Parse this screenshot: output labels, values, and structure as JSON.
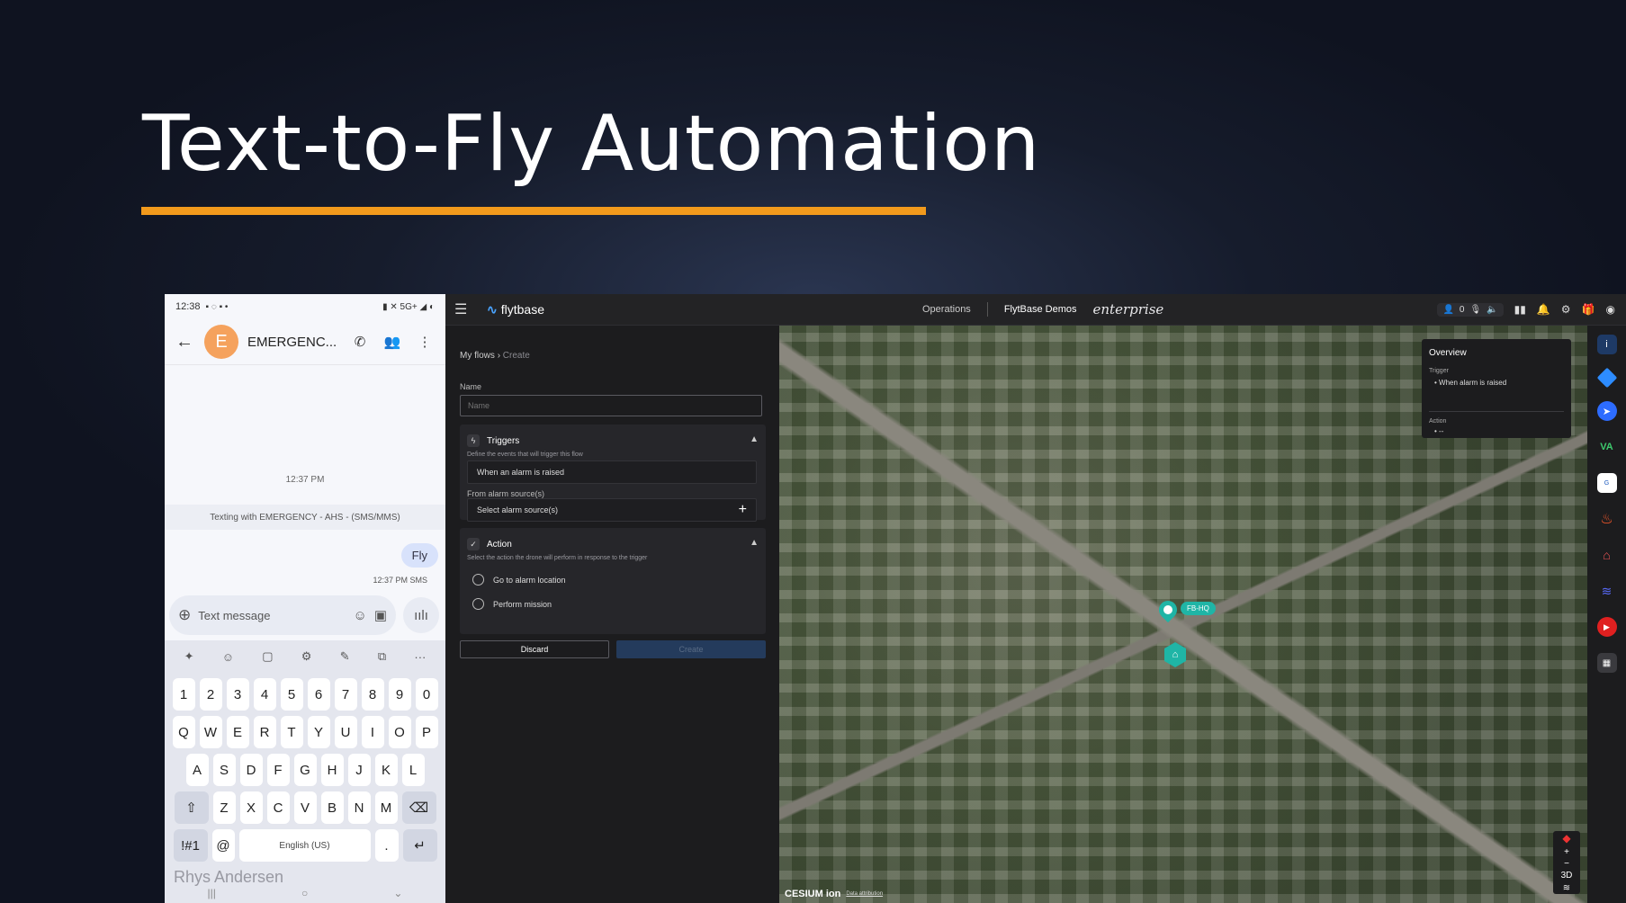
{
  "slide": {
    "title": "Text-to-Fly Automation"
  },
  "phone": {
    "status_time": "12:38",
    "status_icons": "▪ ◌ ▪ •",
    "status_right": "▮ ✕ 5G+ ◢ ◐",
    "contact_initial": "E",
    "contact_name": "EMERGENC...",
    "timestamp_center": "12:37 PM",
    "banner": "Texting with EMERGENCY - AHS - (SMS/MMS)",
    "message_text": "Fly",
    "message_meta": "12:37 PM SMS",
    "compose_placeholder": "Text message",
    "keyboard": {
      "row1": [
        "1",
        "2",
        "3",
        "4",
        "5",
        "6",
        "7",
        "8",
        "9",
        "0"
      ],
      "row2": [
        "Q",
        "W",
        "E",
        "R",
        "T",
        "Y",
        "U",
        "I",
        "O",
        "P"
      ],
      "row3": [
        "A",
        "S",
        "D",
        "F",
        "G",
        "H",
        "J",
        "K",
        "L"
      ],
      "row4": [
        "Z",
        "X",
        "C",
        "V",
        "B",
        "N",
        "M"
      ],
      "sym_key": "!#1",
      "at_key": "@",
      "space_label": "English (US)",
      "dot_key": "."
    },
    "watermark": "Rhys Andersen"
  },
  "app": {
    "logo_text": "flytbase",
    "nav_operations": "Operations",
    "org_name": "FlytBase Demos",
    "edition": "enterprise",
    "user_count": "0",
    "breadcrumb_root": "My flows",
    "breadcrumb_current": "Create",
    "name_label": "Name",
    "name_placeholder": "Name",
    "triggers": {
      "title": "Triggers",
      "description": "Define the events that will trigger this flow",
      "selected_trigger": "When an alarm is raised",
      "source_label": "From alarm source(s)",
      "source_placeholder": "Select alarm source(s)"
    },
    "action": {
      "title": "Action",
      "description": "Select the action the drone will perform in response to the trigger",
      "options": [
        "Go to alarm location",
        "Perform mission"
      ]
    },
    "discard_label": "Discard",
    "create_label": "Create",
    "overview": {
      "title": "Overview",
      "trigger_label": "Trigger",
      "trigger_value": "When alarm is raised",
      "action_label": "Action",
      "action_value": "--"
    },
    "map": {
      "marker_label": "FB-HQ",
      "mode_3d": "3D",
      "cesium_text": "CESIUM ion",
      "attribution": "Data attribution"
    }
  }
}
